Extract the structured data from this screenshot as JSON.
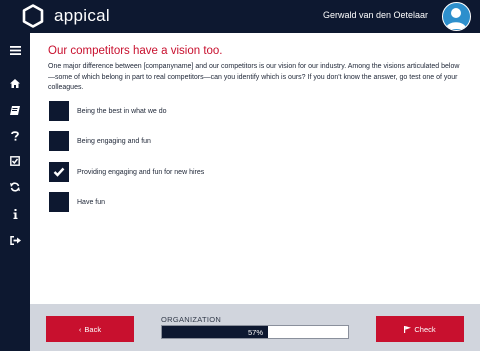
{
  "header": {
    "brand": "appical",
    "user_name": "Gerwald van den Oetelaar"
  },
  "sidebar": {
    "items": [
      {
        "icon": "menu-icon"
      },
      {
        "icon": "home-icon"
      },
      {
        "icon": "book-icon"
      },
      {
        "icon": "help-icon"
      },
      {
        "icon": "checklist-icon"
      },
      {
        "icon": "refresh-icon"
      },
      {
        "icon": "info-icon"
      },
      {
        "icon": "logout-icon"
      }
    ]
  },
  "question": {
    "title": "Our competitors have a vision too.",
    "text": "One major difference between [companyname] and our competitors is our vision for our industry. Among the visions articulated below—some of which belong in part to real competitors—can you identify which is ours? If you don't know the answer, go test one of your colleagues.",
    "options": [
      {
        "label": "Being the best in what we do",
        "checked": false
      },
      {
        "label": "Being engaging and fun",
        "checked": false
      },
      {
        "label": "Providing engaging and fun for new hires",
        "checked": true
      },
      {
        "label": "Have fun",
        "checked": false
      }
    ]
  },
  "footer": {
    "back_label": "Back",
    "check_label": "Check",
    "progress_label": "ORGANIZATION",
    "progress_text": "57%",
    "progress_value": 0.57
  },
  "colors": {
    "navy": "#0d1830",
    "accent_red": "#c8102e",
    "footer_gray": "#d1d5dd",
    "avatar_blue": "#2d8fcc"
  }
}
